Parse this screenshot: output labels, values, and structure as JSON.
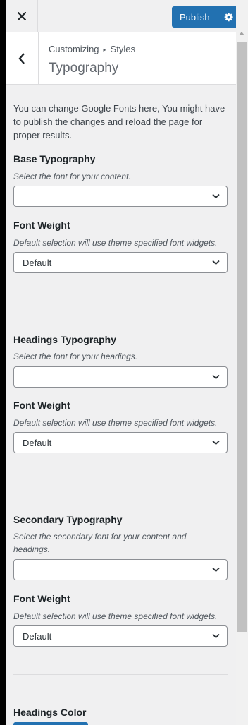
{
  "topbar": {
    "close_icon": "close-icon",
    "publish_label": "Publish",
    "gear_icon": "gear-icon"
  },
  "header": {
    "breadcrumb_root": "Customizing",
    "breadcrumb_current": "Styles",
    "title": "Typography",
    "back_icon": "chevron-left-icon"
  },
  "intro": "You can change Google Fonts here, You might have to publish the changes and reload the page for proper results.",
  "controls": {
    "base": {
      "title": "Base Typography",
      "desc": "Select the font for your content.",
      "value": "",
      "weight_title": "Font Weight",
      "weight_desc": "Default selection will use theme specified font widgets.",
      "weight_value": "Default"
    },
    "headings": {
      "title": "Headings Typography",
      "desc": "Select the font for your headings.",
      "value": "",
      "weight_title": "Font Weight",
      "weight_desc": "Default selection will use theme specified font widgets.",
      "weight_value": "Default"
    },
    "secondary": {
      "title": "Secondary Typography",
      "desc": "Select the secondary font for your content and headings.",
      "value": "",
      "weight_title": "Font Weight",
      "weight_desc": "Default selection will use theme specified font widgets.",
      "weight_value": "Default"
    },
    "headings_color": {
      "title": "Headings Color",
      "color": "#2271b1"
    }
  }
}
